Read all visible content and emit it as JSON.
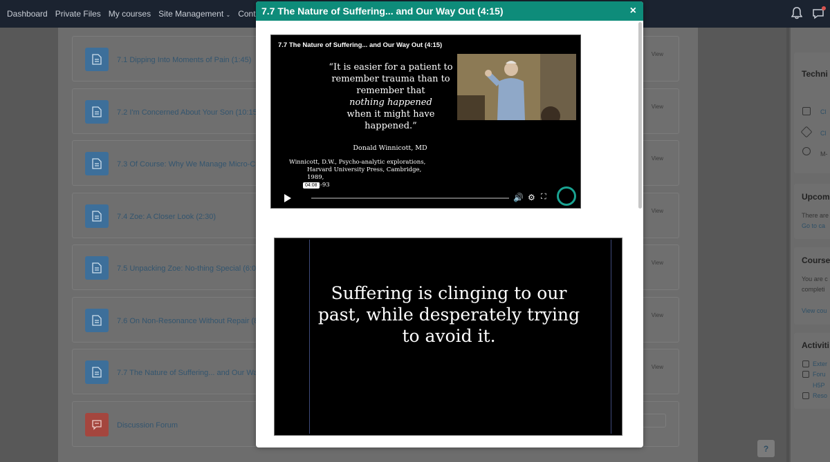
{
  "nav": {
    "items": [
      "Dashboard",
      "Private Files",
      "My courses",
      "Site Management",
      "Content Bank"
    ]
  },
  "activities": [
    {
      "label": "7.1 Dipping Into Moments of Pain (1:45)",
      "action": "View",
      "type": "page"
    },
    {
      "label": "7.2 I'm Concerned About Your Son (10:15)",
      "action": "View",
      "type": "page"
    },
    {
      "label": "7.3 Of Course: Why We Manage Micro-Cue",
      "action": "View",
      "type": "page"
    },
    {
      "label": "7.4 Zoe: A Closer Look (2:30)",
      "action": "View",
      "type": "page"
    },
    {
      "label": "7.5 Unpacking Zoe: No-thing Special (6:00)",
      "action": "View",
      "type": "page"
    },
    {
      "label": "7.6 On Non-Resonance Without Repair (8:3",
      "action": "View",
      "type": "page"
    },
    {
      "label": "7.7 The Nature of Suffering... and Our Way",
      "action": "View",
      "type": "page"
    },
    {
      "label": "Discussion Forum",
      "action": "",
      "type": "forum"
    }
  ],
  "sidebar": {
    "headings": [
      "Techni",
      "Upcom",
      "Course",
      "Activiti"
    ],
    "tech_links": [
      "Cl",
      "Cl",
      "M-"
    ],
    "upcoming_text": "There are",
    "upcoming_link": "Go to ca",
    "course_text_1": "You are c",
    "course_text_2": "completi",
    "course_link": "View cou",
    "activity_links": [
      "Exter",
      "Foru",
      "H5P",
      "Reso"
    ]
  },
  "help_label": "?",
  "modal": {
    "title": "7.7 The Nature of Suffering... and Our Way Out (4:15)",
    "close_label": "×",
    "video": {
      "title": "7.7 The Nature of Suffering... and Our Way Out (4:15)",
      "quote_lines": [
        "“It is easier for a patient to",
        "remember trauma than to",
        "remember that",
        "nothing happened",
        "when it might have",
        "happened.”"
      ],
      "author": "Donald Winnicott, MD",
      "citation_lines": [
        "Winnicott, D.W., Psycho-analytic explorations,",
        "Harvard University Press, Cambridge, 1989,",
        "p.93-93"
      ],
      "time_tooltip": "04:08",
      "progress": 0.0
    },
    "slide_text": [
      "Suffering is clinging to our",
      "past, while desperately trying",
      "to avoid it."
    ]
  },
  "colors": {
    "navbar": "#1b2330",
    "modal_header": "#0e8c7a",
    "page_icon": "#3d6f9a",
    "forum_icon": "#a4463e"
  }
}
